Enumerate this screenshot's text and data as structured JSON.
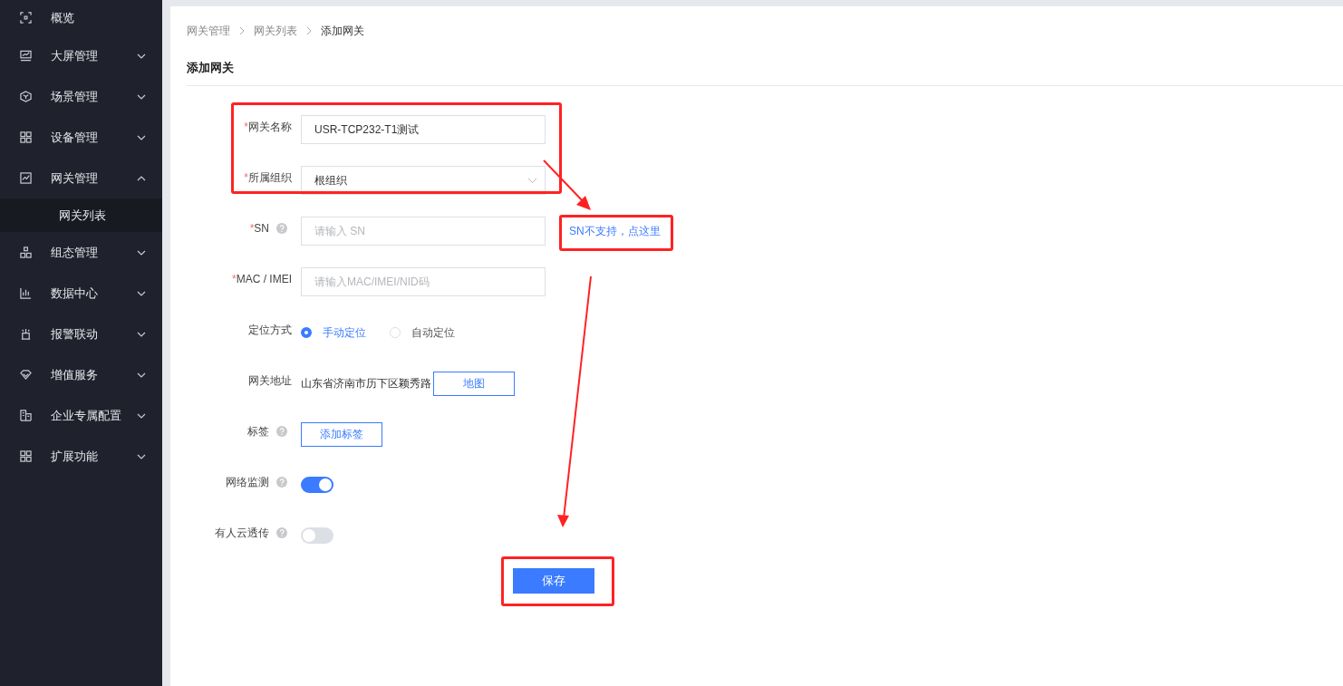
{
  "sidebar": {
    "items": [
      {
        "label": "概览"
      },
      {
        "label": "大屏管理",
        "expanded": false
      },
      {
        "label": "场景管理",
        "expanded": false
      },
      {
        "label": "设备管理",
        "expanded": false
      },
      {
        "label": "网关管理",
        "expanded": true,
        "children": [
          {
            "label": "网关列表",
            "selected": true
          }
        ]
      },
      {
        "label": "组态管理",
        "expanded": false
      },
      {
        "label": "数据中心",
        "expanded": false
      },
      {
        "label": "报警联动",
        "expanded": false
      },
      {
        "label": "增值服务",
        "expanded": false
      },
      {
        "label": "企业专属配置",
        "expanded": false
      },
      {
        "label": "扩展功能",
        "expanded": false
      }
    ]
  },
  "breadcrumb": [
    "网关管理",
    "网关列表",
    "添加网关"
  ],
  "title": "添加网关",
  "form": {
    "fields": [
      {
        "kind": "input",
        "label": "网关名称",
        "required_mark": "*",
        "value": "USR-TCP232-T1测试"
      },
      {
        "kind": "select",
        "label": "所属组织",
        "required_mark": "*",
        "value": "根组织"
      },
      {
        "kind": "input",
        "label": "SN",
        "required_mark": "*",
        "help": true,
        "placeholder": "请输入 SN",
        "link": "SN不支持，点这里"
      },
      {
        "kind": "input",
        "label": "MAC / IMEI",
        "required_mark": "*",
        "placeholder": "请输入MAC/IMEI/NID码"
      },
      {
        "kind": "radio",
        "label": "定位方式",
        "options": [
          {
            "label": "手动定位",
            "selected": true
          },
          {
            "label": "自动定位",
            "selected": false
          }
        ]
      },
      {
        "kind": "address",
        "label": "网关地址",
        "value": "山东省济南市历下区颖秀路",
        "button": "地图"
      },
      {
        "kind": "button",
        "label": "标签",
        "help": true,
        "button": "添加标签"
      },
      {
        "kind": "switch",
        "label": "网络监测",
        "help": true,
        "on": true
      },
      {
        "kind": "switch",
        "label": "有人云透传",
        "help": true,
        "on": false
      }
    ],
    "submit": "保存"
  }
}
